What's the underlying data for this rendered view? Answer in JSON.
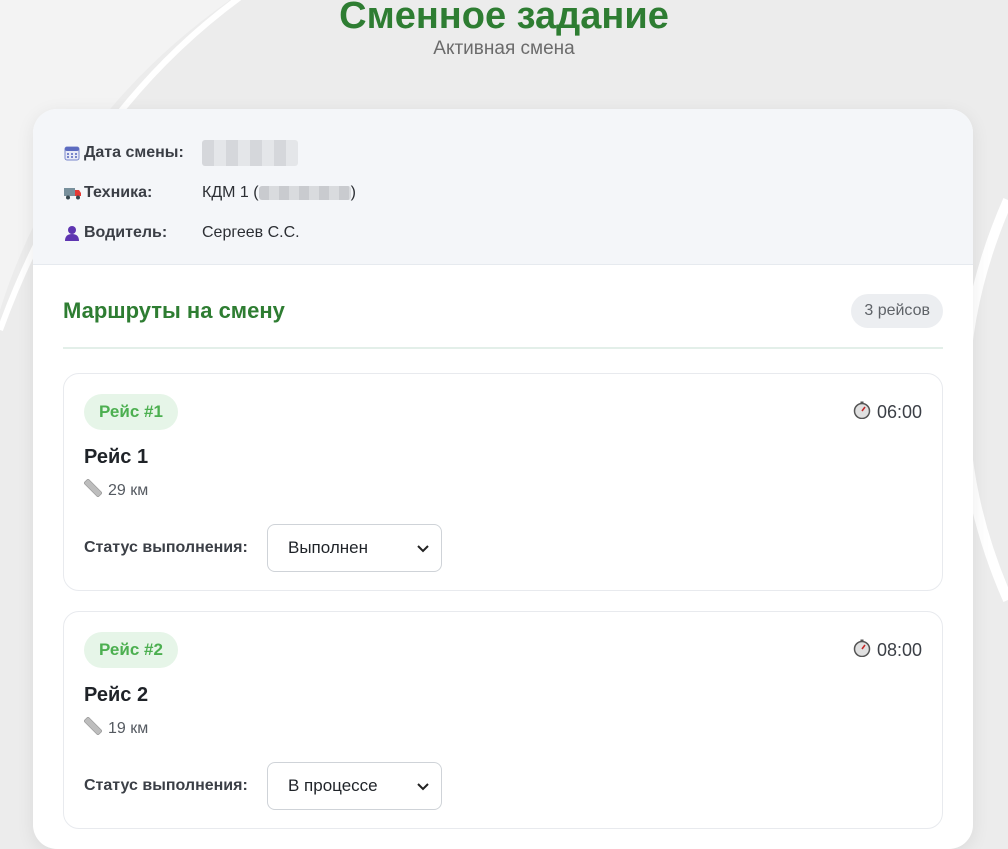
{
  "header": {
    "title": "Сменное задание",
    "subtitle": "Активная смена"
  },
  "info": {
    "date": {
      "label": "Дата смены:",
      "value": ""
    },
    "vehicle": {
      "label": "Техника:",
      "value_prefix": "КДМ 1 (",
      "value_suffix": ")"
    },
    "driver": {
      "label": "Водитель:",
      "value": "Сергеев С.С."
    }
  },
  "routes": {
    "title": "Маршруты на смену",
    "count": "3 рейсов",
    "trips": [
      {
        "badge": "Рейс #1",
        "time": "06:00",
        "name": "Рейс 1",
        "distance": "29 км",
        "status_label": "Статус выполнения:",
        "status_value": "Выполнен"
      },
      {
        "badge": "Рейс #2",
        "time": "08:00",
        "name": "Рейс 2",
        "distance": "19 км",
        "status_label": "Статус выполнения:",
        "status_value": "В процессе"
      }
    ]
  },
  "colors": {
    "brand_green": "#2e7d32",
    "badge_green": "#4caf50",
    "badge_bg": "#e6f5e8"
  },
  "icons": {
    "date": "calendar-icon",
    "vehicle": "truck-icon",
    "driver": "person-icon",
    "time": "stopwatch-icon",
    "distance": "ruler-icon",
    "select": "chevron-down-icon"
  }
}
